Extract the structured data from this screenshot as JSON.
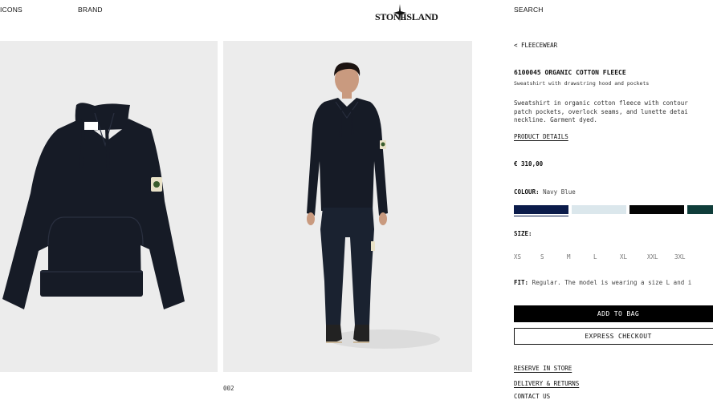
{
  "header": {
    "nav_left_1": "ICONS",
    "nav_left_2": "BRAND",
    "logo_left": "STONE",
    "logo_right": "ISLAND",
    "nav_right": "SEARCH"
  },
  "gallery": {
    "image_counter": "002"
  },
  "product": {
    "breadcrumb": "< FLEECEWEAR",
    "title": "6100045 ORGANIC COTTON FLEECE",
    "subtitle": "Sweatshirt with drawstring hood and pockets",
    "description_lines": [
      "Sweatshirt in organic cotton fleece with contour",
      "patch pockets, overlock seams, and lunette detai",
      "neckline. Garment dyed."
    ],
    "details_link": "PRODUCT DETAILS",
    "price": "€ 310,00",
    "colour_label": "COLOUR:",
    "colour_value": "Navy Blue",
    "swatches": [
      {
        "name": "Navy Blue",
        "color": "#0b1b4a",
        "selected": true
      },
      {
        "name": "Light Blue",
        "color": "#dbe7ec",
        "selected": false
      },
      {
        "name": "Black",
        "color": "#050505",
        "selected": false
      },
      {
        "name": "Green",
        "color": "#0f3d3a",
        "selected": false
      }
    ],
    "size_label": "SIZE:",
    "sizes": [
      "XS",
      "S",
      "M",
      "L",
      "XL",
      "XXL",
      "3XL"
    ],
    "fit_label": "FIT:",
    "fit_value": "Regular. The model is wearing a size L and i",
    "add_to_bag": "ADD TO BAG",
    "express_checkout": "EXPRESS CHECKOUT",
    "reserve_link": "RESERVE IN STORE",
    "delivery_link": "DELIVERY & RETURNS",
    "contact_link": "CONTACT US"
  },
  "colors": {
    "garment": "#161b26",
    "panel_bg": "#ececec",
    "button_bg": "#000000"
  }
}
